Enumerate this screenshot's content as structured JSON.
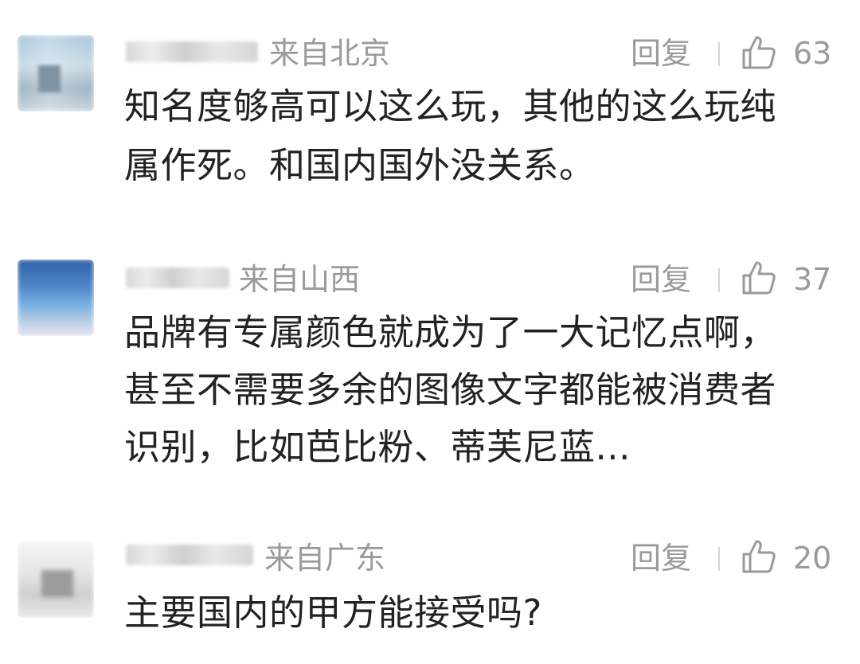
{
  "comments": [
    {
      "location": "来自北京",
      "reply_label": "回复",
      "likes": "63",
      "text_lines": [
        "知名度够高可以这么玩，其他的这么玩纯",
        "属作死。和国内国外没关系。"
      ]
    },
    {
      "location": "来自山西",
      "reply_label": "回复",
      "likes": "37",
      "text_lines": [
        "品牌有专属颜色就成为了一大记忆点啊，",
        "甚至不需要多余的图像文字都能被消费者",
        "识别，比如芭比粉、蒂芙尼蓝..."
      ]
    },
    {
      "location": "来自广东",
      "reply_label": "回复",
      "likes": "20",
      "text_lines": [
        "主要国内的甲方能接受吗?"
      ]
    }
  ],
  "icons": {
    "like": "thumbs-up-icon"
  },
  "colors": {
    "text": "#222222",
    "meta": "#9a9a9a"
  }
}
